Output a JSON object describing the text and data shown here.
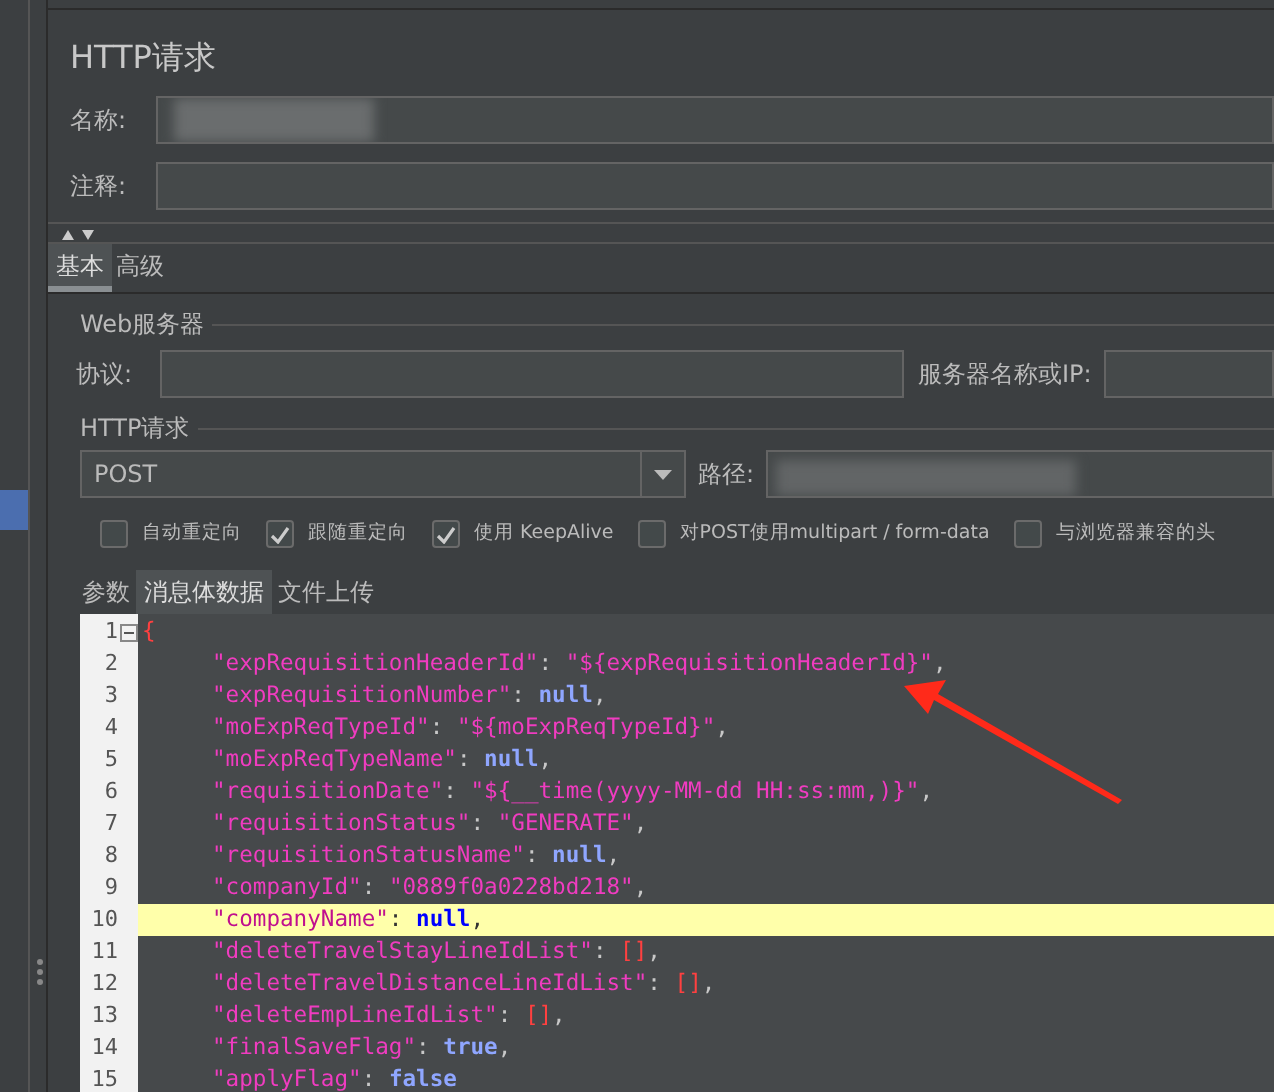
{
  "title": "HTTP请求",
  "name": {
    "label": "名称:",
    "redacted": true
  },
  "comment": {
    "label": "注释:"
  },
  "tabs": [
    {
      "label": "基本",
      "selected": true
    },
    {
      "label": "高级",
      "selected": false
    }
  ],
  "web_server": {
    "legend": "Web服务器",
    "protocol_label": "协议:",
    "server_label": "服务器名称或IP:"
  },
  "http_request": {
    "legend": "HTTP请求",
    "method": "POST",
    "path_label": "路径:",
    "path_redacted": true
  },
  "options": [
    {
      "label": "自动重定向",
      "checked": false
    },
    {
      "label": "跟随重定向",
      "checked": true
    },
    {
      "label": "使用 KeepAlive",
      "checked": true
    },
    {
      "label": "对POST使用multipart / form-data",
      "checked": false
    },
    {
      "label": "与浏览器兼容的头",
      "checked": false
    }
  ],
  "body_tabs": [
    {
      "label": "参数",
      "selected": false
    },
    {
      "label": "消息体数据",
      "selected": true
    },
    {
      "label": "文件上传",
      "selected": false
    }
  ],
  "code_lines": [
    {
      "number": "1",
      "indented": false,
      "highlighted": false,
      "foldable": true,
      "tokens": [
        {
          "kind": "brace",
          "text": "{"
        }
      ]
    },
    {
      "number": "2",
      "foldable": false,
      "indented": true,
      "highlighted": false,
      "tokens": [
        {
          "kind": "key",
          "text": "\"expRequisitionHeaderId\""
        },
        {
          "kind": "punct",
          "text": ": "
        },
        {
          "kind": "string",
          "text": "\"${expRequisitionHeaderId}\""
        },
        {
          "kind": "punct",
          "text": ","
        }
      ]
    },
    {
      "number": "3",
      "foldable": false,
      "indented": true,
      "highlighted": false,
      "tokens": [
        {
          "kind": "key",
          "text": "\"expRequisitionNumber\""
        },
        {
          "kind": "punct",
          "text": ": "
        },
        {
          "kind": "keyword",
          "text": "null"
        },
        {
          "kind": "punct",
          "text": ","
        }
      ]
    },
    {
      "number": "4",
      "foldable": false,
      "indented": true,
      "highlighted": false,
      "tokens": [
        {
          "kind": "key",
          "text": "\"moExpReqTypeId\""
        },
        {
          "kind": "punct",
          "text": ": "
        },
        {
          "kind": "string",
          "text": "\"${moExpReqTypeId}\""
        },
        {
          "kind": "punct",
          "text": ","
        }
      ]
    },
    {
      "number": "5",
      "foldable": false,
      "indented": true,
      "highlighted": false,
      "tokens": [
        {
          "kind": "key",
          "text": "\"moExpReqTypeName\""
        },
        {
          "kind": "punct",
          "text": ": "
        },
        {
          "kind": "keyword",
          "text": "null"
        },
        {
          "kind": "punct",
          "text": ","
        }
      ]
    },
    {
      "number": "6",
      "foldable": false,
      "indented": true,
      "highlighted": false,
      "tokens": [
        {
          "kind": "key",
          "text": "\"requisitionDate\""
        },
        {
          "kind": "punct",
          "text": ": "
        },
        {
          "kind": "string",
          "text": "\"${__time(yyyy-MM-dd HH:ss:mm,)}\""
        },
        {
          "kind": "punct",
          "text": ","
        }
      ]
    },
    {
      "number": "7",
      "foldable": false,
      "indented": true,
      "highlighted": false,
      "tokens": [
        {
          "kind": "key",
          "text": "\"requisitionStatus\""
        },
        {
          "kind": "punct",
          "text": ": "
        },
        {
          "kind": "string",
          "text": "\"GENERATE\""
        },
        {
          "kind": "punct",
          "text": ","
        }
      ]
    },
    {
      "number": "8",
      "foldable": false,
      "indented": true,
      "highlighted": false,
      "tokens": [
        {
          "kind": "key",
          "text": "\"requisitionStatusName\""
        },
        {
          "kind": "punct",
          "text": ": "
        },
        {
          "kind": "keyword",
          "text": "null"
        },
        {
          "kind": "punct",
          "text": ","
        }
      ]
    },
    {
      "number": "9",
      "foldable": false,
      "indented": true,
      "highlighted": false,
      "tokens": [
        {
          "kind": "key",
          "text": "\"companyId\""
        },
        {
          "kind": "punct",
          "text": ": "
        },
        {
          "kind": "string",
          "text": "\"0889f0a0228bd218\""
        },
        {
          "kind": "punct",
          "text": ","
        }
      ]
    },
    {
      "number": "10",
      "foldable": false,
      "indented": true,
      "highlighted": true,
      "tokens": [
        {
          "kind": "key",
          "text": "\"companyName\""
        },
        {
          "kind": "punct",
          "text": ": "
        },
        {
          "kind": "keyword",
          "text": "null"
        },
        {
          "kind": "punct",
          "text": ","
        }
      ]
    },
    {
      "number": "11",
      "foldable": false,
      "indented": true,
      "highlighted": false,
      "tokens": [
        {
          "kind": "key",
          "text": "\"deleteTravelStayLineIdList\""
        },
        {
          "kind": "punct",
          "text": ": "
        },
        {
          "kind": "bracket",
          "text": "[]"
        },
        {
          "kind": "punct",
          "text": ","
        }
      ]
    },
    {
      "number": "12",
      "foldable": false,
      "indented": true,
      "highlighted": false,
      "tokens": [
        {
          "kind": "key",
          "text": "\"deleteTravelDistanceLineIdList\""
        },
        {
          "kind": "punct",
          "text": ": "
        },
        {
          "kind": "bracket",
          "text": "[]"
        },
        {
          "kind": "punct",
          "text": ","
        }
      ]
    },
    {
      "number": "13",
      "foldable": false,
      "indented": true,
      "highlighted": false,
      "tokens": [
        {
          "kind": "key",
          "text": "\"deleteEmpLineIdList\""
        },
        {
          "kind": "punct",
          "text": ": "
        },
        {
          "kind": "bracket",
          "text": "[]"
        },
        {
          "kind": "punct",
          "text": ","
        }
      ]
    },
    {
      "number": "14",
      "foldable": false,
      "indented": true,
      "highlighted": false,
      "tokens": [
        {
          "kind": "key",
          "text": "\"finalSaveFlag\""
        },
        {
          "kind": "punct",
          "text": ": "
        },
        {
          "kind": "keyword",
          "text": "true"
        },
        {
          "kind": "punct",
          "text": ","
        }
      ]
    },
    {
      "number": "15",
      "foldable": false,
      "indented": true,
      "highlighted": false,
      "tokens": [
        {
          "kind": "key",
          "text": "\"applyFlag\""
        },
        {
          "kind": "punct",
          "text": ": "
        },
        {
          "kind": "keyword",
          "text": "false"
        }
      ]
    }
  ],
  "annotation": {
    "kind": "arrow"
  }
}
